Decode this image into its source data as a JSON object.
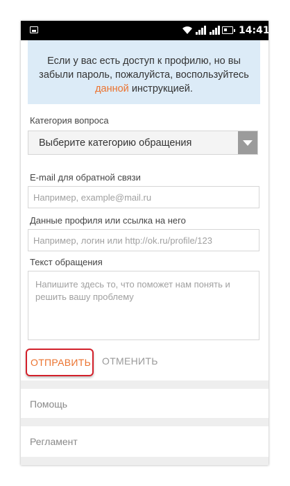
{
  "status_bar": {
    "time": "14:41",
    "icons": [
      "image-notification-icon",
      "wifi-icon",
      "signal-icon",
      "signal-icon",
      "battery-icon"
    ]
  },
  "notice": {
    "text_before": "Если у вас есть доступ к профилю, но вы забыли пароль, пожалуйста, воспользуйтесь ",
    "link_text": "данной",
    "text_after": " инструкцией."
  },
  "form": {
    "category": {
      "label": "Категория вопроса",
      "selected": "Выберите категорию обращения"
    },
    "email": {
      "label": "E-mail для обратной связи",
      "placeholder": "Например, example@mail.ru"
    },
    "profile": {
      "label": "Данные профиля или ссылка на него",
      "placeholder": "Например, логин или http://ok.ru/profile/123"
    },
    "message": {
      "label": "Текст обращения",
      "placeholder": "Напишите здесь то, что поможет нам понять и решить вашу проблему"
    },
    "send_label": "ОТПРАВИТЬ",
    "cancel_label": "ОТМЕНИТЬ"
  },
  "menu": {
    "items": [
      {
        "label": "Помощь"
      },
      {
        "label": "Регламент"
      }
    ]
  },
  "colors": {
    "accent": "#eb722e",
    "notice_bg": "#dcebf7",
    "highlight": "#d3202a",
    "status_bar": "#000000"
  }
}
